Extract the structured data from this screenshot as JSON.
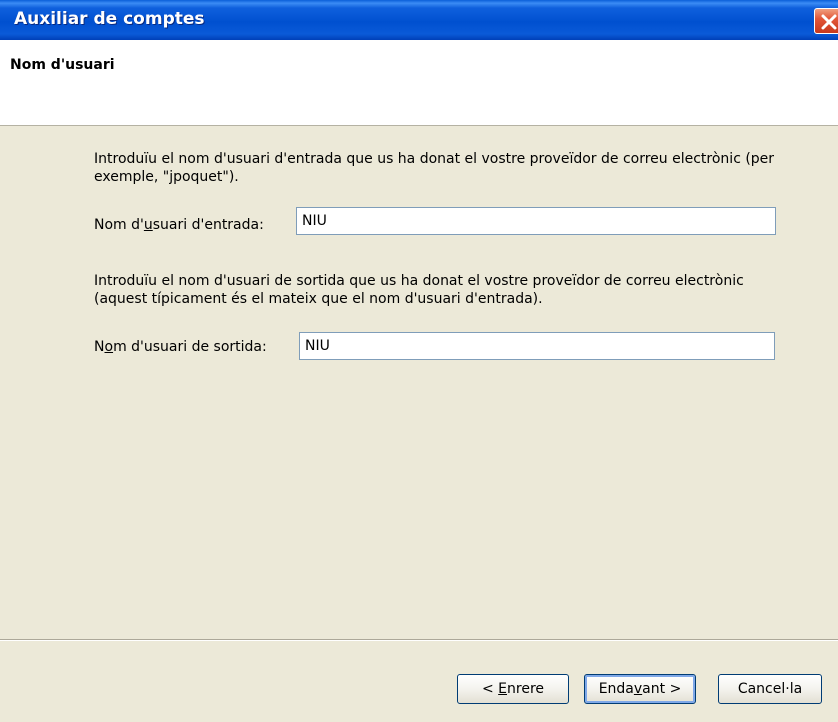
{
  "window": {
    "title": "Auxiliar de comptes"
  },
  "header": {
    "title": "Nom d'usuari"
  },
  "incoming": {
    "description": "Introduïu el nom d'usuari d'entrada que us ha donat el vostre proveïdor de correu electrònic (per exemple, \"jpoquet\").",
    "label_pre": "Nom d'",
    "label_accel": "u",
    "label_post": "suari d'entrada:",
    "value": "NIU"
  },
  "outgoing": {
    "description": "Introduïu el nom d'usuari de sortida que us ha donat el vostre proveïdor de correu electrònic (aquest típicament és el mateix que el nom d'usuari d'entrada).",
    "label_pre": "N",
    "label_accel": "o",
    "label_post": "m d'usuari de sortida:",
    "value": "NIU"
  },
  "buttons": {
    "back_pre": "< ",
    "back_accel": "E",
    "back_post": "nrere",
    "next_pre": "Enda",
    "next_accel": "v",
    "next_post": "ant >",
    "cancel": "Cancel·la"
  },
  "colors": {
    "titlebar": "#0050d0",
    "close": "#e2573a",
    "dialog_bg": "#ece9d8"
  }
}
